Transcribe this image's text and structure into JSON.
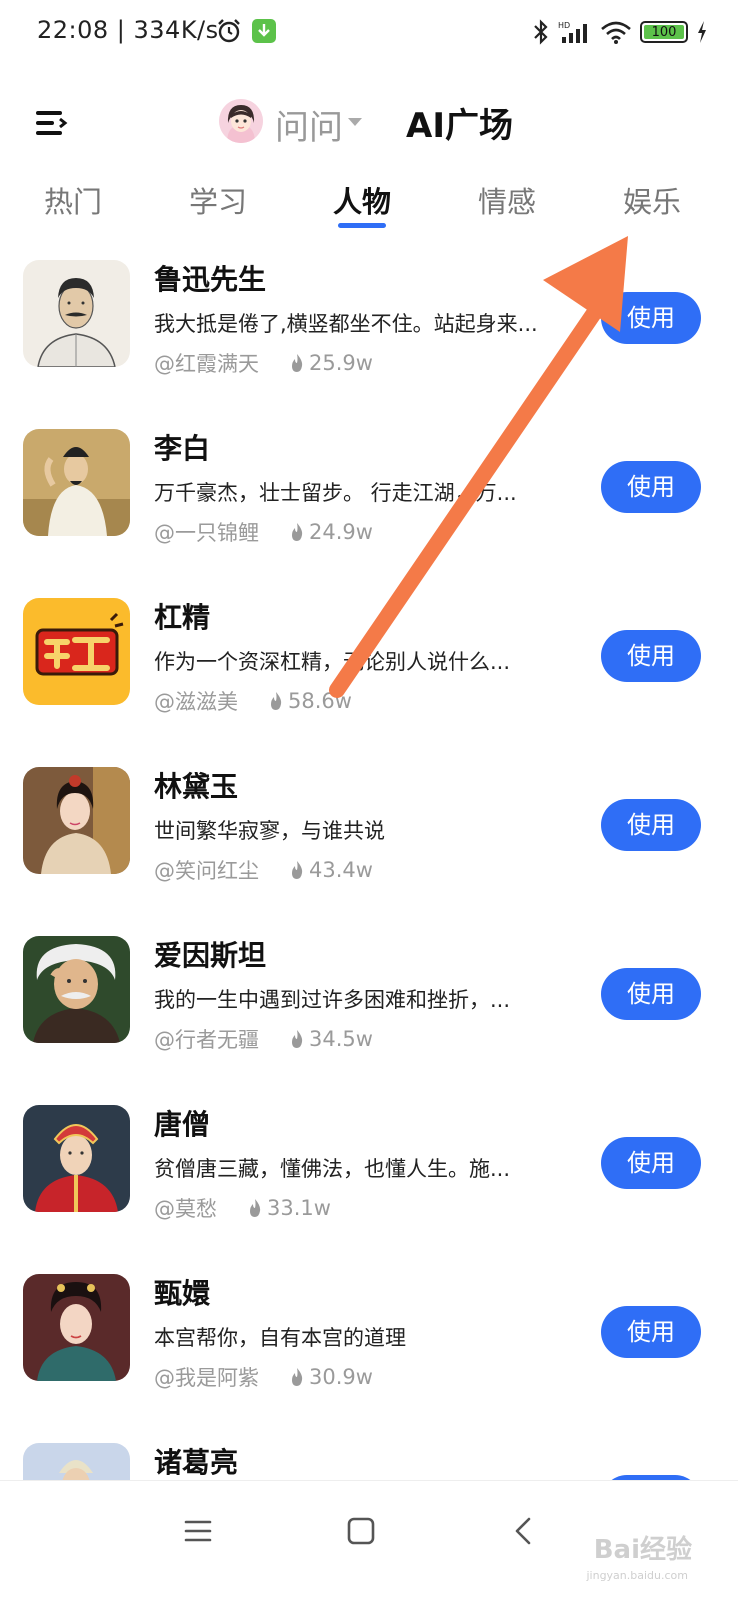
{
  "status_bar": {
    "time": "22:08 | 334K/s",
    "battery": "100"
  },
  "header": {
    "assistant_name": "问问",
    "title": "AI广场"
  },
  "tabs": [
    {
      "label": "热门"
    },
    {
      "label": "学习"
    },
    {
      "label": "人物",
      "active": true
    },
    {
      "label": "情感"
    },
    {
      "label": "娱乐"
    }
  ],
  "items": [
    {
      "title": "鲁迅先生",
      "desc": "我大抵是倦了,横竖都坐不住。站起身来...",
      "author": "@红霞满天",
      "heat": "25.9w",
      "button": "使用"
    },
    {
      "title": "李白",
      "desc": "万千豪杰，壮士留步。 行走江湖，万...",
      "author": "@一只锦鲤",
      "heat": "24.9w",
      "button": "使用"
    },
    {
      "title": "杠精",
      "desc": "作为一个资深杠精，无论别人说什么...",
      "author": "@滋滋美",
      "heat": "58.6w",
      "button": "使用"
    },
    {
      "title": "林黛玉",
      "desc": "世间繁华寂寥，与谁共说",
      "author": "@笑问红尘",
      "heat": "43.4w",
      "button": "使用"
    },
    {
      "title": "爱因斯坦",
      "desc": "我的一生中遇到过许多困难和挫折，...",
      "author": "@行者无疆",
      "heat": "34.5w",
      "button": "使用"
    },
    {
      "title": "唐僧",
      "desc": "贫僧唐三藏，懂佛法，也懂人生。施...",
      "author": "@莫愁",
      "heat": "33.1w",
      "button": "使用"
    },
    {
      "title": "甄嬛",
      "desc": "本宫帮你，自有本宫的道理",
      "author": "@我是阿紫",
      "heat": "30.9w",
      "button": "使用"
    },
    {
      "title": "诸葛亮",
      "desc": "",
      "author": "",
      "heat": "",
      "button": "使用"
    }
  ],
  "colors": {
    "accent": "#2f6ef6",
    "annotation_arrow": "#f47a48"
  },
  "icons": {
    "menu": "menu-icon",
    "alarm": "alarm-icon",
    "download": "download-icon",
    "bluetooth": "bluetooth-icon",
    "signal": "signal-icon",
    "wifi": "wifi-icon",
    "battery": "battery-icon",
    "charging": "charging-icon",
    "flame": "flame-icon",
    "nav_menu": "nav-menu-icon",
    "nav_home": "nav-home-icon",
    "nav_back": "nav-back-icon"
  },
  "watermark": {
    "brand": "Bai经验",
    "url": "jingyan.baidu.com"
  }
}
